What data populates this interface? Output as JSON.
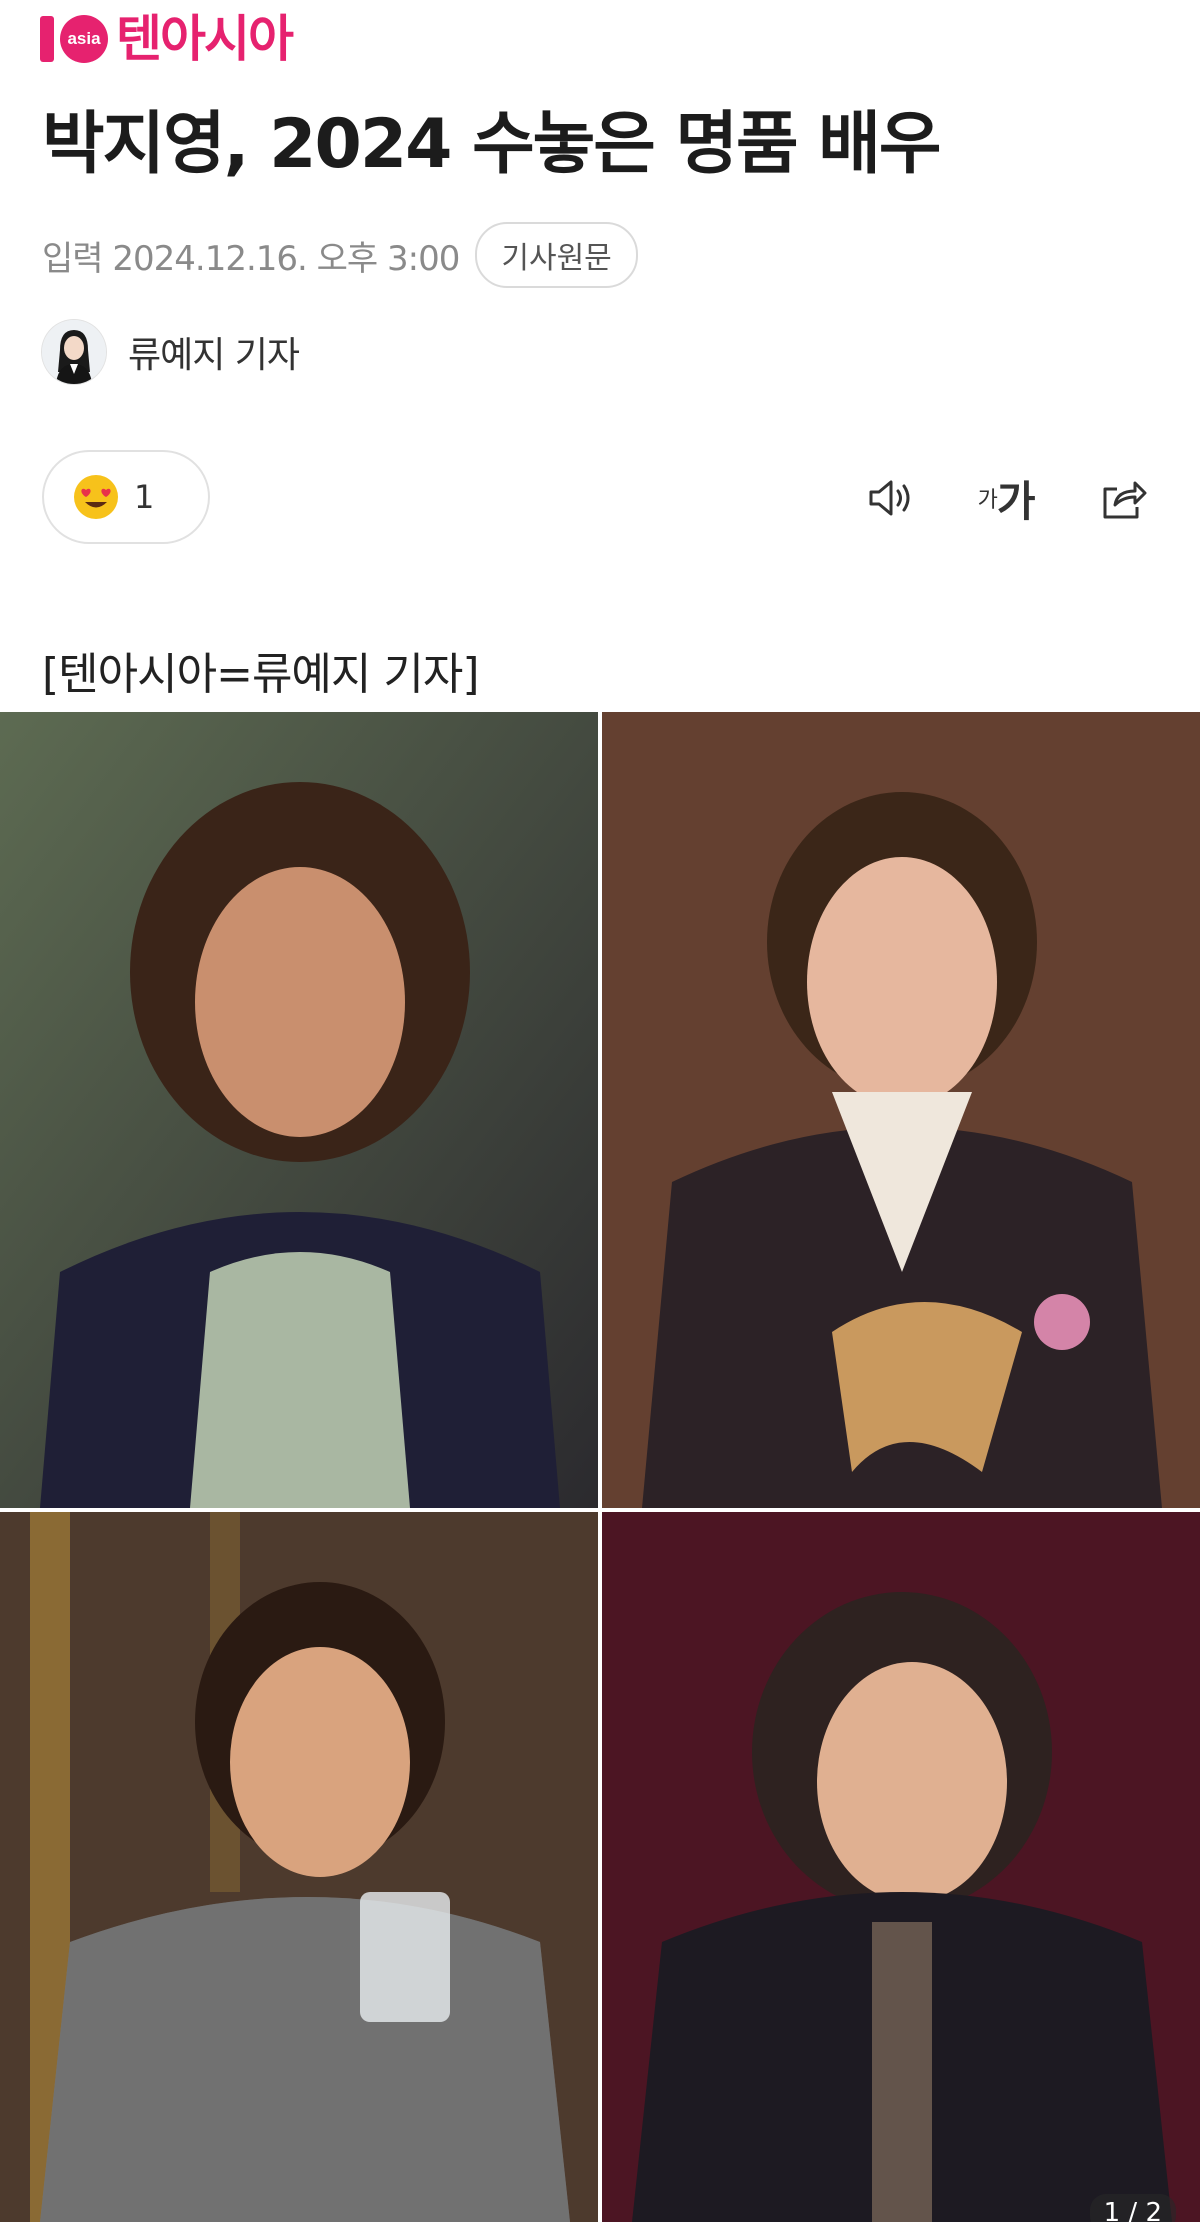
{
  "header": {
    "logo_text": "10asia",
    "logo_badge": "asia",
    "brand_name": "텐아시아"
  },
  "article": {
    "title": "박지영, 2024 수놓은 명품 배우",
    "date": "입력 2024.12.16. 오후 3:00",
    "original_link_label": "기사원문",
    "author_name": "류예지 기자",
    "reaction_count": "1",
    "font_button_small": "가",
    "font_button_large": "가",
    "byline": "[텐아시아=류예지 기자]"
  },
  "photos": {
    "page_indicator": "1 / 2"
  },
  "icons": {
    "reaction": "heart-eyes-emoji-icon",
    "listen": "speaker-icon",
    "share": "share-icon"
  },
  "colors": {
    "brand": "#e6226f",
    "meta_text": "#8a8a8a"
  }
}
